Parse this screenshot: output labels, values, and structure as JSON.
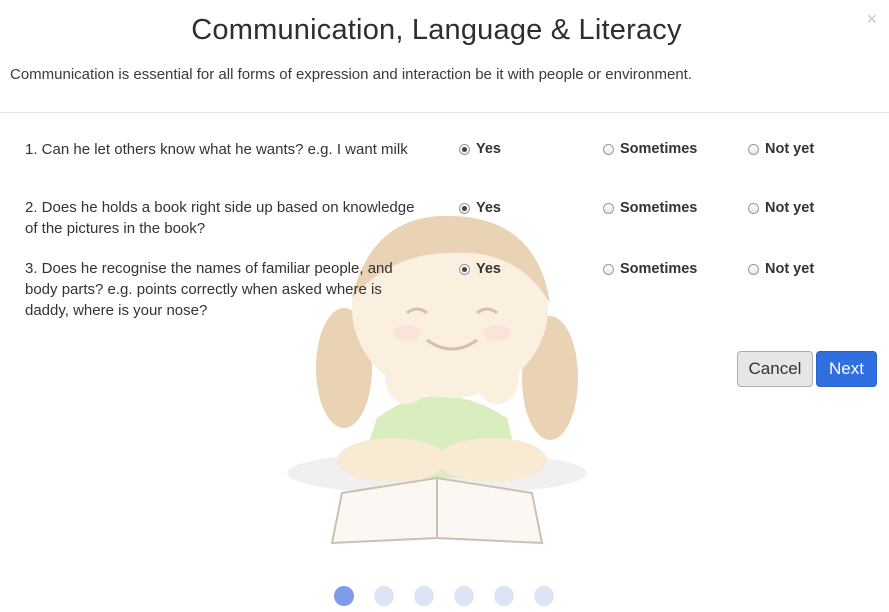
{
  "modal": {
    "title": "Communication, Language & Literacy",
    "subtitle": "Communication is essential for all forms of expression and interaction be it with people or environment.",
    "close_label": "×"
  },
  "questions": [
    {
      "text": "1. Can he let others know what he wants? e.g. I want milk",
      "options": [
        "Yes",
        "Sometimes",
        "Not yet"
      ],
      "selected": "Yes"
    },
    {
      "text": "2. Does he holds a book right side up based on knowledge of the pictures in the book?",
      "options": [
        "Yes",
        "Sometimes",
        "Not yet"
      ],
      "selected": "Yes"
    },
    {
      "text": "3. Does he recognise the names of familiar people, and body parts? e.g. points correctly when asked where is daddy, where is your nose?",
      "options": [
        "Yes",
        "Sometimes",
        "Not yet"
      ],
      "selected": "Yes"
    }
  ],
  "actions": {
    "cancel_label": "Cancel",
    "next_label": "Next"
  },
  "pager": {
    "total": 6,
    "current": 1
  },
  "colors": {
    "accent": "#2f6fe0",
    "dot_active": "#7d9cea",
    "dot_inactive": "#dde4f6"
  }
}
